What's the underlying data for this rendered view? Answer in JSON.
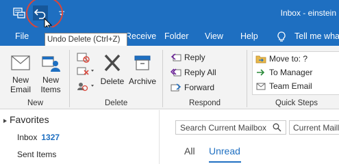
{
  "title_bar": {
    "title": "Inbox - einstein",
    "icons": [
      "send-receive-all-icon",
      "undo-icon",
      "quick-access-dropdown-icon"
    ]
  },
  "menu": {
    "items": [
      "File",
      "Receive",
      "Folder",
      "View",
      "Help",
      "Tell me wha"
    ]
  },
  "tooltip": {
    "text": "Undo Delete (Ctrl+Z)"
  },
  "ribbon": {
    "new_group": {
      "label": "New",
      "new_email": [
        "New",
        "Email"
      ],
      "new_items": [
        "New",
        "Items"
      ]
    },
    "delete_group": {
      "label": "Delete",
      "delete": "Delete",
      "archive": "Archive"
    },
    "respond_group": {
      "label": "Respond",
      "reply": "Reply",
      "reply_all": "Reply All",
      "forward": "Forward"
    },
    "quick_steps_group": {
      "label": "Quick Steps",
      "move_to": "Move to: ?",
      "to_manager": "To Manager",
      "team_email": "Team Email"
    }
  },
  "nav_pane": {
    "favorites": "Favorites",
    "inbox": {
      "label": "Inbox",
      "count": "1327"
    },
    "sent": "Sent Items"
  },
  "message_list": {
    "search_placeholder": "Search Current Mailbox",
    "scope": "Current Mailbox",
    "filter_all": "All",
    "filter_unread": "Unread"
  },
  "colors": {
    "brand_blue": "#1e6fc1",
    "highlight_red": "#d9463a"
  }
}
